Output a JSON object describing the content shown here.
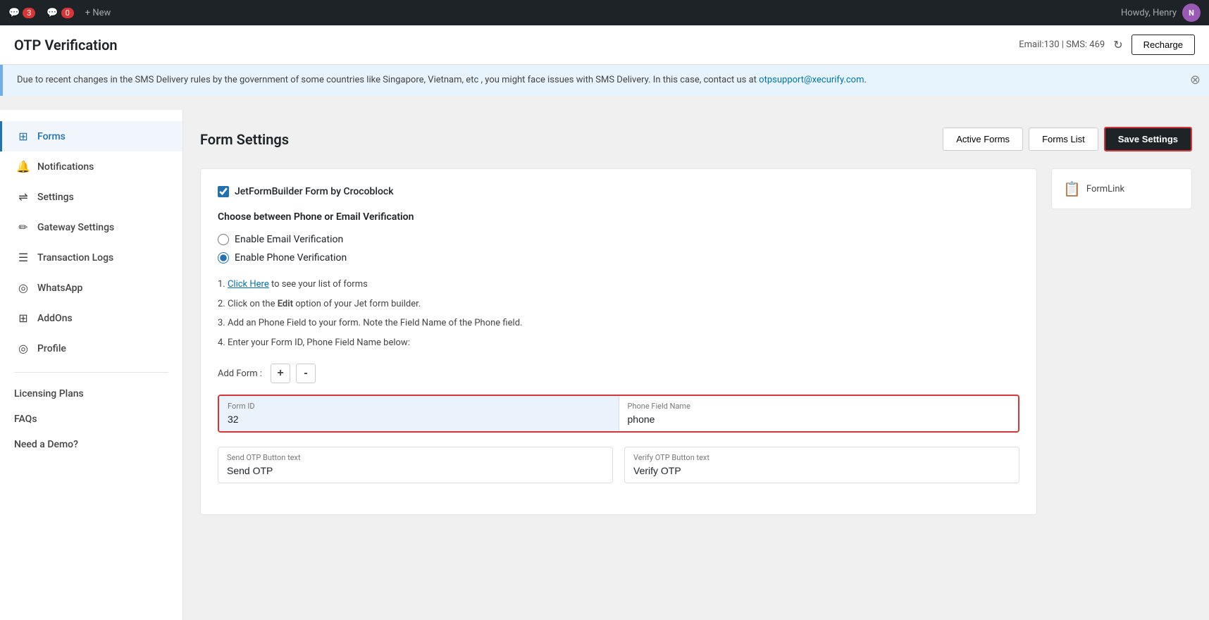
{
  "admin_bar": {
    "comments_count": "3",
    "updates_count": "0",
    "new_label": "+ New",
    "howdy_text": "Howdy, Henry",
    "user_initial": "N"
  },
  "plugin_header": {
    "title": "OTP Verification",
    "email_sms_info": "Email:130 | SMS: 469",
    "recharge_label": "Recharge"
  },
  "notice": {
    "text": "Due to recent changes in the SMS Delivery rules by the government of some countries like Singapore, Vietnam, etc , you might face issues with SMS Delivery. In this case, contact us at",
    "link_text": "otpsupport@xecurify.com",
    "link_href": "mailto:otpsupport@xecurify.com"
  },
  "sidebar": {
    "items": [
      {
        "id": "forms",
        "label": "Forms",
        "icon": "⊞",
        "active": true
      },
      {
        "id": "notifications",
        "label": "Notifications",
        "icon": "🔔",
        "active": false
      },
      {
        "id": "settings",
        "label": "Settings",
        "icon": "⇌",
        "active": false
      },
      {
        "id": "gateway-settings",
        "label": "Gateway Settings",
        "icon": "✏",
        "active": false
      },
      {
        "id": "transaction-logs",
        "label": "Transaction Logs",
        "icon": "☰",
        "active": false
      },
      {
        "id": "whatsapp",
        "label": "WhatsApp",
        "icon": "◎",
        "active": false
      },
      {
        "id": "addons",
        "label": "AddOns",
        "icon": "⊞",
        "active": false
      },
      {
        "id": "profile",
        "label": "Profile",
        "icon": "◎",
        "active": false
      }
    ],
    "links": [
      {
        "id": "licensing",
        "label": "Licensing Plans"
      },
      {
        "id": "faqs",
        "label": "FAQs"
      },
      {
        "id": "demo",
        "label": "Need a Demo?"
      }
    ]
  },
  "main": {
    "title": "Form Settings",
    "active_forms_label": "Active Forms",
    "forms_list_label": "Forms List",
    "save_settings_label": "Save Settings",
    "form_builder_label": "JetFormBuilder Form by Crocoblock",
    "form_builder_checked": true,
    "verification_section_heading": "Choose between Phone or Email Verification",
    "radio_options": [
      {
        "id": "email",
        "label": "Enable Email Verification",
        "checked": false
      },
      {
        "id": "phone",
        "label": "Enable Phone Verification",
        "checked": true
      }
    ],
    "instructions": [
      {
        "num": "1.",
        "link_text": "Click Here",
        "rest": " to see your list of forms"
      },
      {
        "num": "2.",
        "text": "Click on the ",
        "bold": "Edit",
        "rest": " option of your Jet form builder."
      },
      {
        "num": "3.",
        "text": "Add an Phone Field to your form. Note the Field Name of the Phone field."
      },
      {
        "num": "4.",
        "text": "Enter your Form ID, Phone Field Name below:"
      }
    ],
    "add_form_label": "Add Form :",
    "add_btn": "+",
    "remove_btn": "-",
    "form_id_label": "Form ID",
    "form_id_value": "32",
    "phone_field_label": "Phone Field Name",
    "phone_field_value": "phone",
    "send_otp_label": "Send OTP Button text",
    "send_otp_value": "Send OTP",
    "verify_otp_label": "Verify OTP Button text",
    "verify_otp_value": "Verify OTP"
  },
  "right_panel": {
    "formlink_label": "FormLink"
  }
}
